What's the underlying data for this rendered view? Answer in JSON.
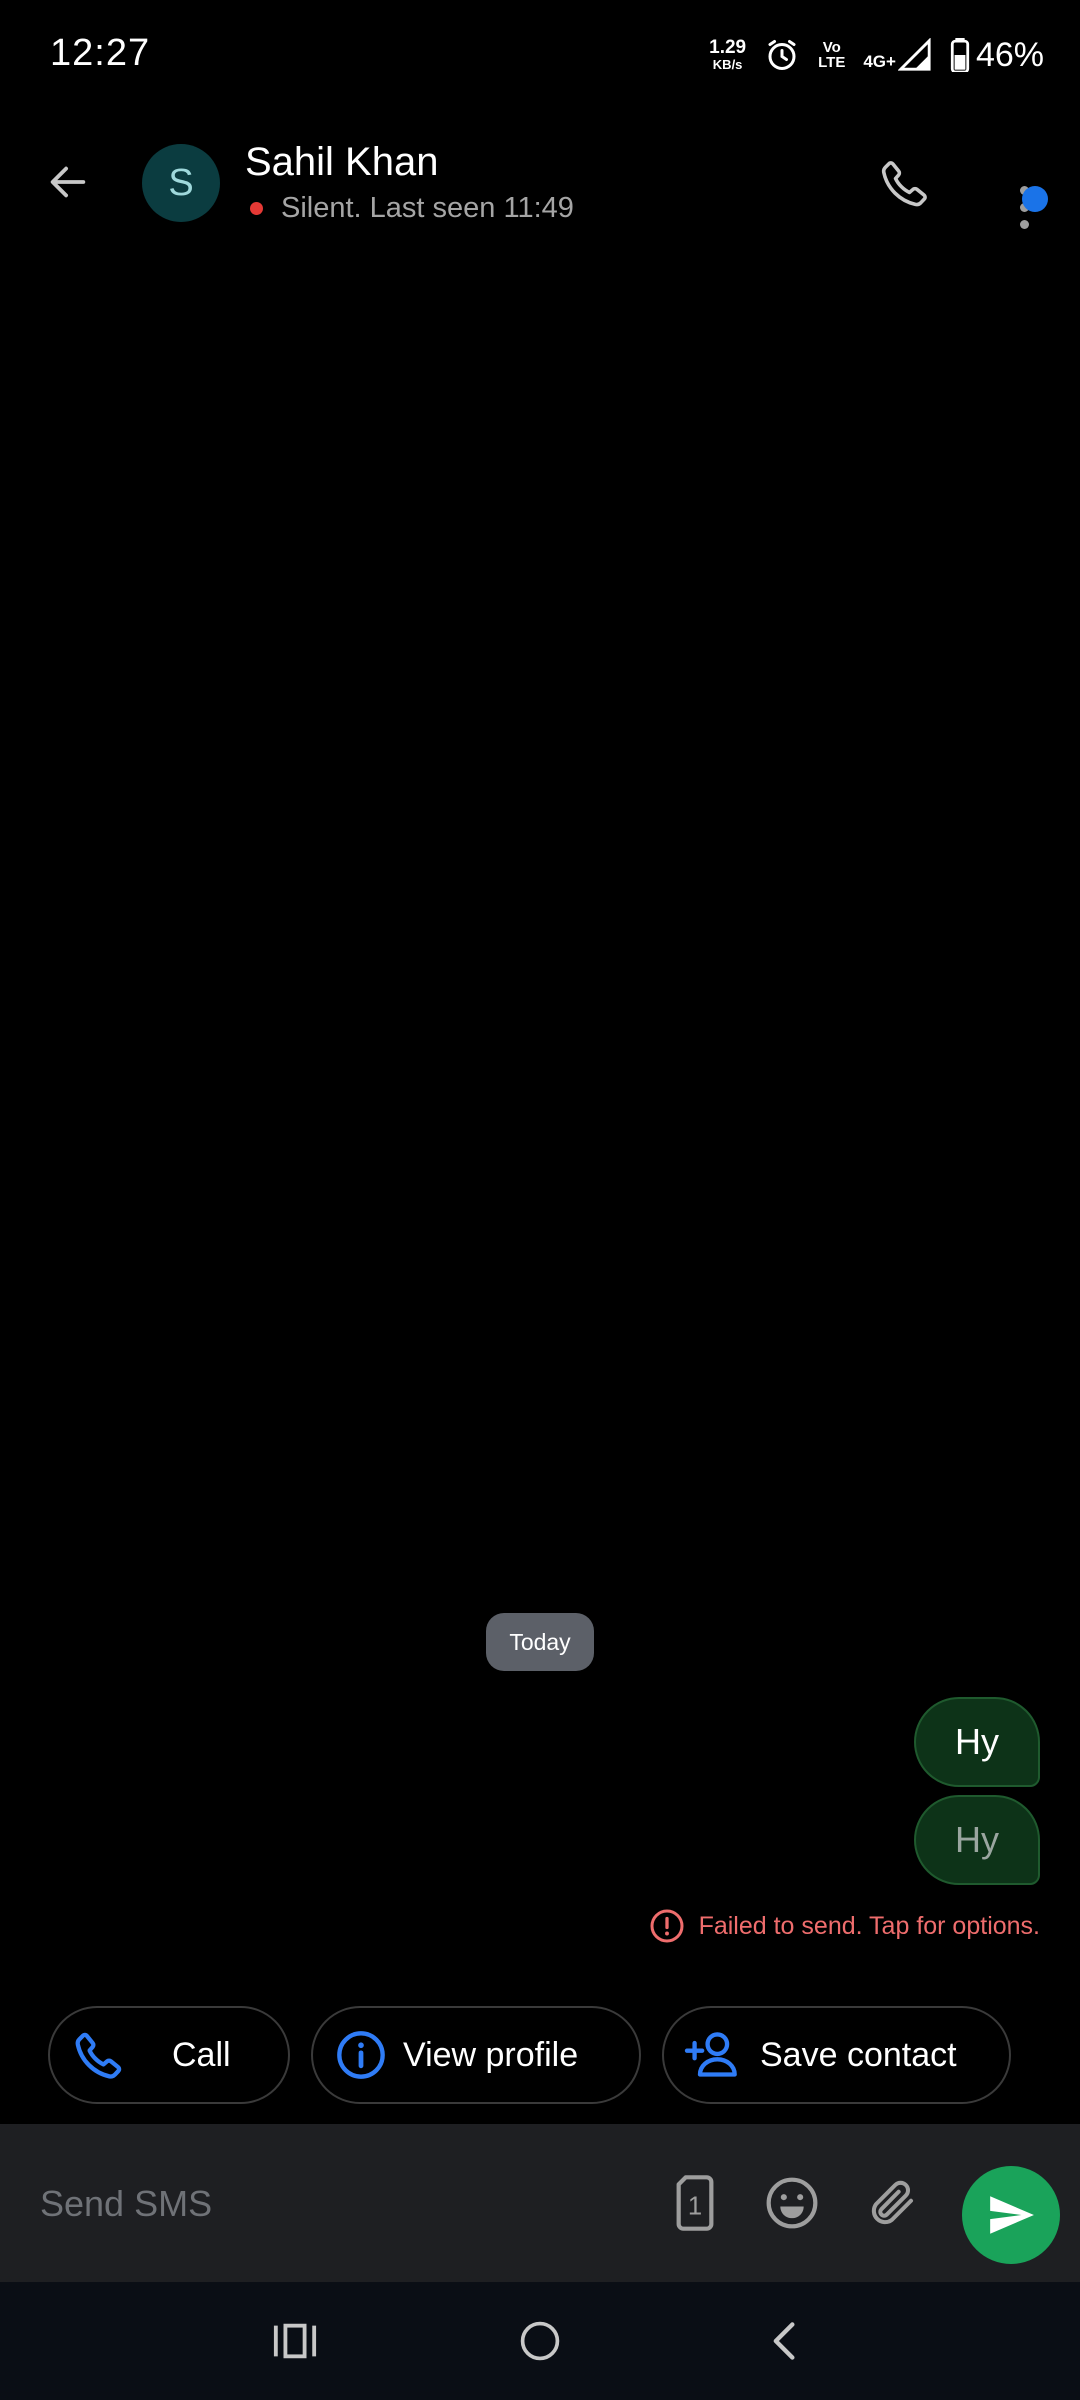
{
  "status_bar": {
    "time": "12:27",
    "net_speed_value": "1.29",
    "net_speed_unit": "KB/s",
    "volte_top": "Vo",
    "volte_bottom": "LTE",
    "network": "4G+",
    "battery": "46%"
  },
  "header": {
    "avatar_letter": "S",
    "contact_name": "Sahil Khan",
    "status_text": "Silent. Last seen 11:49"
  },
  "conversation": {
    "date_chip": "Today",
    "messages": [
      {
        "text": "Hy"
      },
      {
        "text": "Hy"
      }
    ],
    "failed_text": "Failed to send. Tap for options."
  },
  "actions": {
    "call_label": "Call",
    "view_profile_label": "View profile",
    "save_contact_label": "Save contact"
  },
  "composer": {
    "placeholder": "Send SMS",
    "sim_number": "1"
  },
  "colors": {
    "accent_blue": "#1a73e8",
    "send_green": "#1aa35a",
    "error_red": "#ef6d6d",
    "bubble_bg": "#0d3318"
  },
  "icons": [
    "back-arrow-icon",
    "phone-icon",
    "kebab-menu-icon",
    "error-icon",
    "info-icon",
    "person-add-icon",
    "sim-card-icon",
    "emoji-icon",
    "attachment-icon",
    "send-icon",
    "recents-icon",
    "home-icon",
    "nav-back-icon"
  ]
}
